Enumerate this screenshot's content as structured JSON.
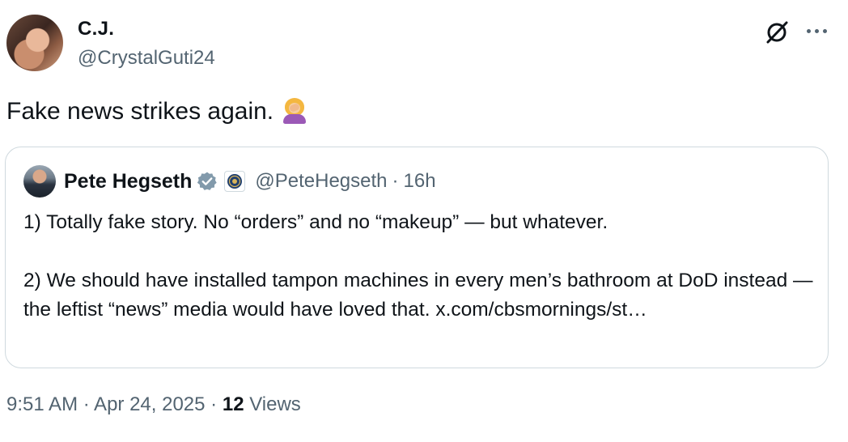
{
  "post": {
    "author": {
      "name": "C.J.",
      "handle": "@CrystalGuti24"
    },
    "text": "Fake news strikes again.",
    "emoji": "woman-facepalming-emoji",
    "timestamp": "9:51 AM · Apr 24, 2025",
    "separator": "·",
    "views": {
      "count": "12",
      "label": "Views"
    }
  },
  "quote": {
    "author": {
      "name": "Pete Hegseth",
      "handle": "@PeteHegseth"
    },
    "dot": "·",
    "time": "16h",
    "text": "1) Totally fake story. No “orders” and no “makeup” — but whatever.\n\n2) We should have installed tampon machines in every men’s bathroom at DoD instead — the leftist “news” media would have loved that. x.com/cbsmornings/st…"
  },
  "icons": {
    "grok": "grok-icon",
    "more": "more-icon",
    "verified": "verified-badge-icon",
    "affiliate": "dod-seal-icon"
  },
  "colors": {
    "text": "#0f1419",
    "secondary": "#536471",
    "border": "#cfd9de",
    "verified_gray": "#829aab"
  }
}
